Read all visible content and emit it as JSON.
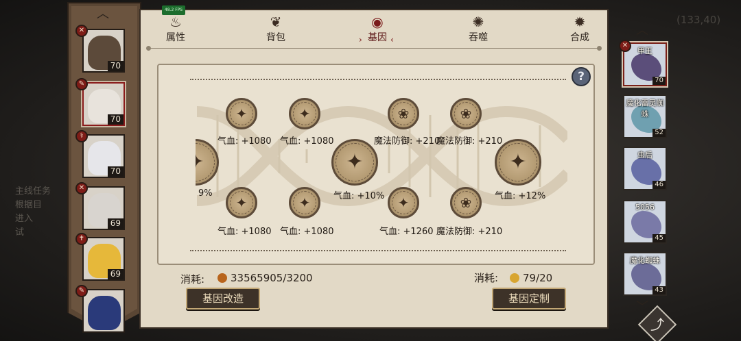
{
  "background": {
    "coord": "(133,40)",
    "task_lines": "主线任务\n根据目\n进入\n试",
    "theme": "#1f1d1b"
  },
  "fps": "48.2 FPS",
  "heroes": [
    {
      "level": "70",
      "badge": "✕"
    },
    {
      "level": "70",
      "badge": "✎",
      "selected": true
    },
    {
      "level": "70",
      "badge": "⚕"
    },
    {
      "level": "69",
      "badge": "✕"
    },
    {
      "level": "69",
      "badge": "✝"
    },
    {
      "level": "",
      "badge": "✎"
    }
  ],
  "tabs": [
    {
      "label": "属性",
      "icon": "flame-icon"
    },
    {
      "label": "背包",
      "icon": "bag-icon"
    },
    {
      "label": "基因",
      "icon": "eye-icon",
      "active": true
    },
    {
      "label": "吞噬",
      "icon": "swirl-icon"
    },
    {
      "label": "合成",
      "icon": "swirl2-icon"
    }
  ],
  "tab_selector": {
    "left": "›",
    "right": "‹"
  },
  "help_label": "?",
  "gene_nodes": [
    {
      "label": "9%"
    },
    {
      "label": "气血: +1080"
    },
    {
      "label": "气血: +1080"
    },
    {
      "label": "气血: +10%"
    },
    {
      "label": "魔法防御: +210"
    },
    {
      "label": "魔法防御: +210"
    },
    {
      "label": "气血: +12%"
    },
    {
      "label": "气血: +1080"
    },
    {
      "label": "气血: +1080"
    },
    {
      "label": "气血: +1260"
    },
    {
      "label": "魔法防御: +210"
    }
  ],
  "cost_left": {
    "label": "消耗:",
    "value": "33565905/3200",
    "coin_color": "#b8641c"
  },
  "cost_right": {
    "label": "消耗:",
    "value": "79/20",
    "coin_color": "#d8a530"
  },
  "buttons": {
    "modify": "基因改造",
    "customize": "基因定制"
  },
  "pets": [
    {
      "name": "甲王",
      "level": "70",
      "selected": true
    },
    {
      "name": "魔化雷灵蜘蛛",
      "level": "52"
    },
    {
      "name": "虫后",
      "level": "46"
    },
    {
      "name": "5056",
      "level": "45"
    },
    {
      "name": "魔化蜘蛛",
      "level": "43"
    }
  ],
  "close_label": "⤴"
}
